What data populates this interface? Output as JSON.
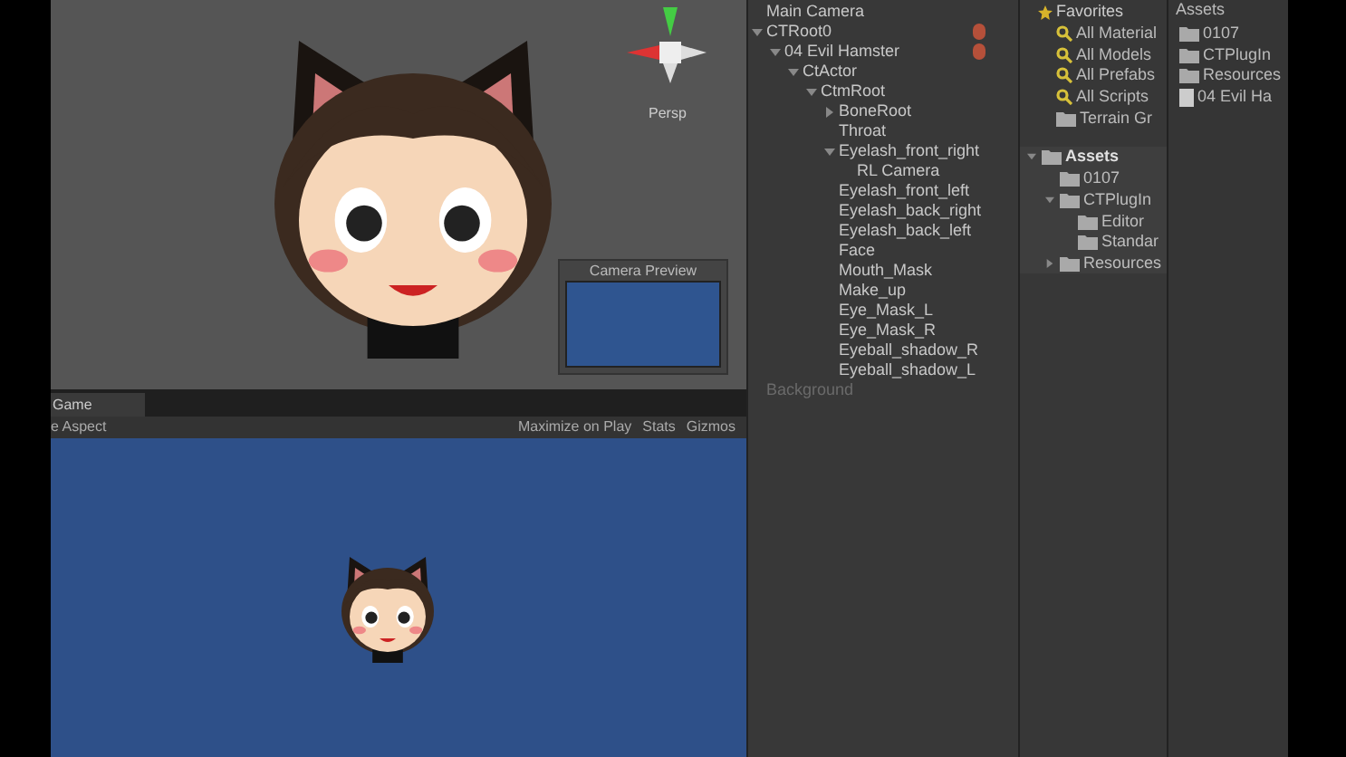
{
  "scene_view": {
    "gizmo_label": "Persp",
    "camera_preview": {
      "title": "Camera Preview"
    }
  },
  "game_view": {
    "tab": {
      "label": "Game",
      "selected": true
    },
    "aspect": "e Aspect",
    "toolbar_buttons": [
      "Maximize on Play",
      "Stats",
      "Gizmos"
    ]
  },
  "hierarchy": {
    "items": [
      {
        "label": "Main Camera",
        "has_icon": false,
        "disabled": false
      },
      {
        "label": "CTRoot0",
        "expanded": true,
        "has_icon": true,
        "disabled": false,
        "children": [
          {
            "label": "04 Evil Hamster",
            "expanded": true,
            "has_icon": true,
            "disabled": false,
            "children": [
              {
                "label": "CtActor",
                "expanded": true,
                "has_icon": false,
                "disabled": false,
                "children": [
                  {
                    "label": "CtmRoot",
                    "expanded": true,
                    "has_icon": false,
                    "disabled": false,
                    "children": [
                      {
                        "label": "BoneRoot",
                        "expanded": false,
                        "has_icon": false,
                        "disabled": false
                      },
                      {
                        "label": "Throat",
                        "has_icon": false,
                        "disabled": false
                      },
                      {
                        "label": "Eyelash_front_right",
                        "expanded": true,
                        "has_icon": false,
                        "disabled": false,
                        "children": [
                          {
                            "label": "RL Camera",
                            "has_icon": false,
                            "disabled": false
                          }
                        ]
                      },
                      {
                        "label": "Eyelash_front_left",
                        "has_icon": false,
                        "disabled": false
                      },
                      {
                        "label": "Eyelash_back_right",
                        "has_icon": false,
                        "disabled": false
                      },
                      {
                        "label": "Eyelash_back_left",
                        "has_icon": false,
                        "disabled": false
                      },
                      {
                        "label": "Face",
                        "has_icon": false,
                        "disabled": false
                      },
                      {
                        "label": "Mouth_Mask",
                        "has_icon": false,
                        "disabled": false
                      },
                      {
                        "label": "Make_up",
                        "has_icon": false,
                        "disabled": false
                      },
                      {
                        "label": "Eye_Mask_L",
                        "has_icon": false,
                        "disabled": false
                      },
                      {
                        "label": "Eye_Mask_R",
                        "has_icon": false,
                        "disabled": false
                      },
                      {
                        "label": "Eyeball_shadow_R",
                        "has_icon": false,
                        "disabled": false
                      },
                      {
                        "label": "Eyeball_shadow_L",
                        "has_icon": false,
                        "disabled": false
                      }
                    ]
                  }
                ]
              }
            ]
          }
        ]
      },
      {
        "label": "Background",
        "has_icon": false,
        "disabled": true
      }
    ]
  },
  "project": {
    "favorites": {
      "label": "Favorites",
      "items": [
        {
          "label": "All Material",
          "kind": "search"
        },
        {
          "label": "All Models",
          "kind": "search"
        },
        {
          "label": "All Prefabs",
          "kind": "search"
        },
        {
          "label": "All Scripts",
          "kind": "search"
        },
        {
          "label": "Terrain Gr",
          "kind": "folder"
        }
      ]
    },
    "assets_tree": {
      "label": "Assets",
      "expanded": true,
      "children": [
        {
          "label": "0107"
        },
        {
          "label": "CTPlugIn",
          "expanded": true,
          "children": [
            {
              "label": "Editor"
            },
            {
              "label": "Standar"
            }
          ]
        },
        {
          "label": "Resources",
          "expanded": false
        }
      ]
    },
    "folder_header": "Assets",
    "folder_items": [
      {
        "label": "0107",
        "kind": "folder"
      },
      {
        "label": "CTPlugIn",
        "kind": "folder"
      },
      {
        "label": "Resources",
        "kind": "folder"
      },
      {
        "label": "04 Evil Ha",
        "kind": "file"
      }
    ]
  }
}
